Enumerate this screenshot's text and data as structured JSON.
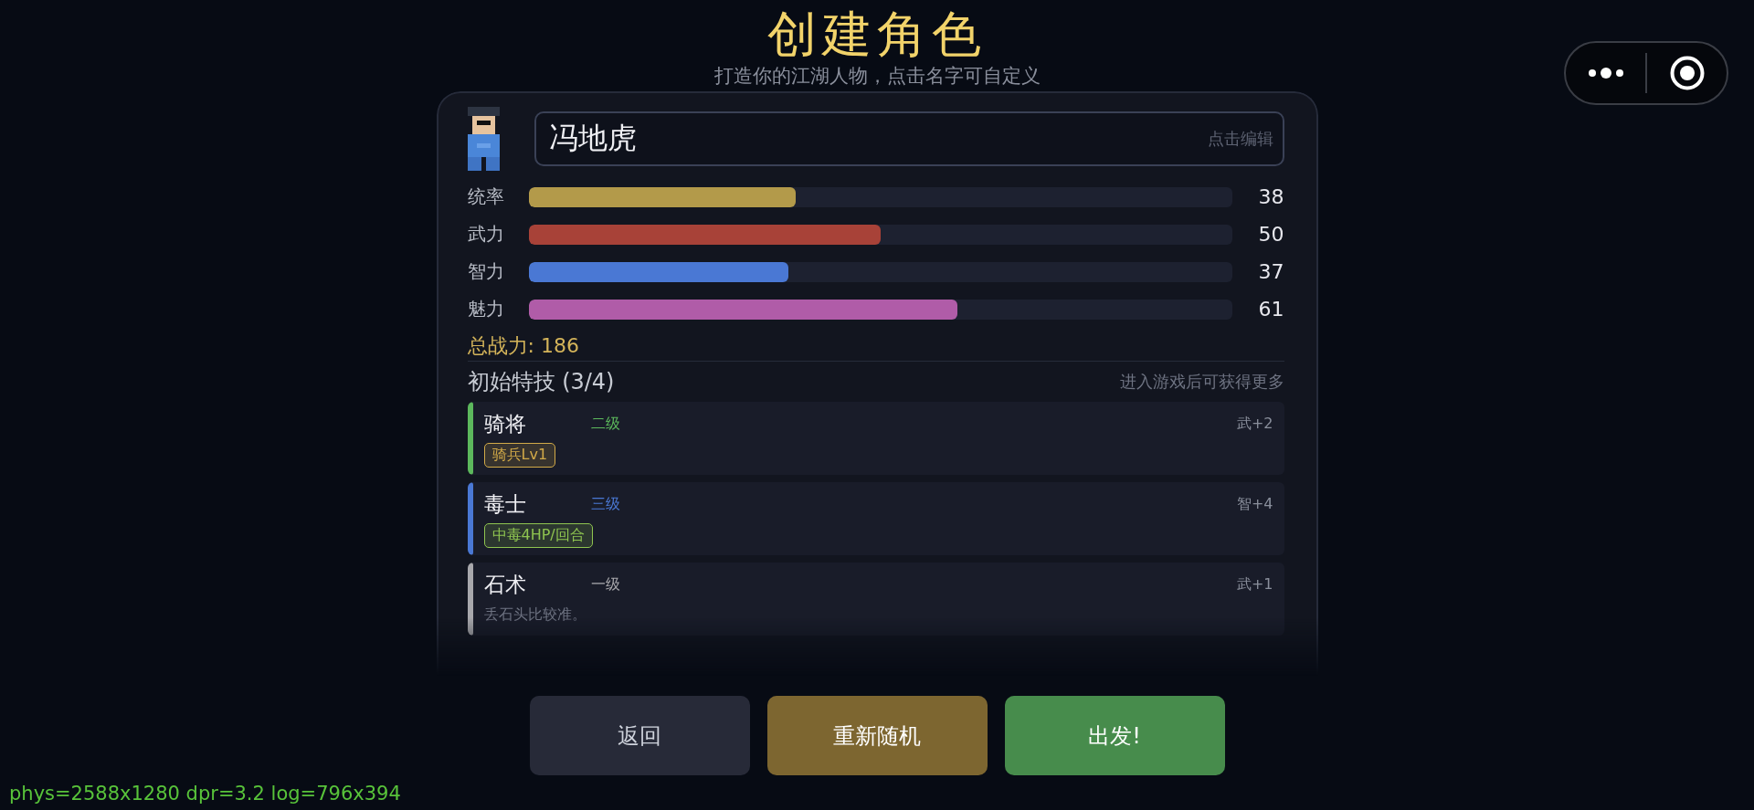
{
  "title": "创建角色",
  "subtitle": "打造你的江湖人物，点击名字可自定义",
  "name_field": {
    "value": "冯地虎",
    "edit_hint": "点击编辑"
  },
  "stats": [
    {
      "label": "统率",
      "value": "38",
      "level": 0.38,
      "color": "#b39a4a"
    },
    {
      "label": "武力",
      "value": "50",
      "level": 0.5,
      "color": "#a84238"
    },
    {
      "label": "智力",
      "value": "37",
      "level": 0.37,
      "color": "#4a78d4"
    },
    {
      "label": "魅力",
      "value": "61",
      "level": 0.61,
      "color": "#b05ca8"
    }
  ],
  "total": "总战力: 186",
  "skills_header": {
    "title": "初始特技 (3/4)",
    "note": "进入游戏后可获得更多"
  },
  "skills": [
    {
      "kind": "tag",
      "name": "骑将",
      "tier": "二级",
      "bonus": "武+2",
      "color": "#5cb85c",
      "tag": {
        "text": "骑兵Lv1",
        "color": "#d2aa48"
      }
    },
    {
      "kind": "tag",
      "name": "毒士",
      "tier": "三级",
      "bonus": "智+4",
      "color": "#4a78d4",
      "tag": {
        "text": "中毒4HP/回合",
        "color": "#8fc550"
      }
    },
    {
      "kind": "desc",
      "name": "石术",
      "tier": "一级",
      "bonus": "武+1",
      "color": "#a8a8ac",
      "desc": "丢石头比较准。"
    }
  ],
  "buttons": [
    {
      "kind": "back",
      "label": "返回"
    },
    {
      "kind": "reroll",
      "label": "重新随机"
    },
    {
      "kind": "go",
      "label": "出发!"
    }
  ],
  "debug": "phys=2588x1280 dpr=3.2 log=796x394"
}
